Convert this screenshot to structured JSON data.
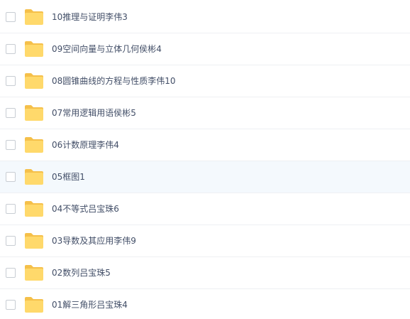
{
  "colors": {
    "folder": "#ffd96b",
    "folder_dark": "#f5c04a",
    "text": "#424e67",
    "hover_row": "#f4f9fd"
  },
  "hovered_index": 5,
  "files": [
    {
      "name": "10推理与证明李伟3",
      "icon": "folder-icon"
    },
    {
      "name": "09空间向量与立体几何侯彬4",
      "icon": "folder-icon"
    },
    {
      "name": "08圆锥曲线的方程与性质李伟10",
      "icon": "folder-icon"
    },
    {
      "name": "07常用逻辑用语侯彬5",
      "icon": "folder-icon"
    },
    {
      "name": "06计数原理李伟4",
      "icon": "folder-icon"
    },
    {
      "name": "05框图1",
      "icon": "folder-icon"
    },
    {
      "name": "04不等式吕宝珠6",
      "icon": "folder-icon"
    },
    {
      "name": "03导数及其应用李伟9",
      "icon": "folder-icon"
    },
    {
      "name": "02数列吕宝珠5",
      "icon": "folder-icon"
    },
    {
      "name": "01解三角形吕宝珠4",
      "icon": "folder-icon"
    }
  ]
}
